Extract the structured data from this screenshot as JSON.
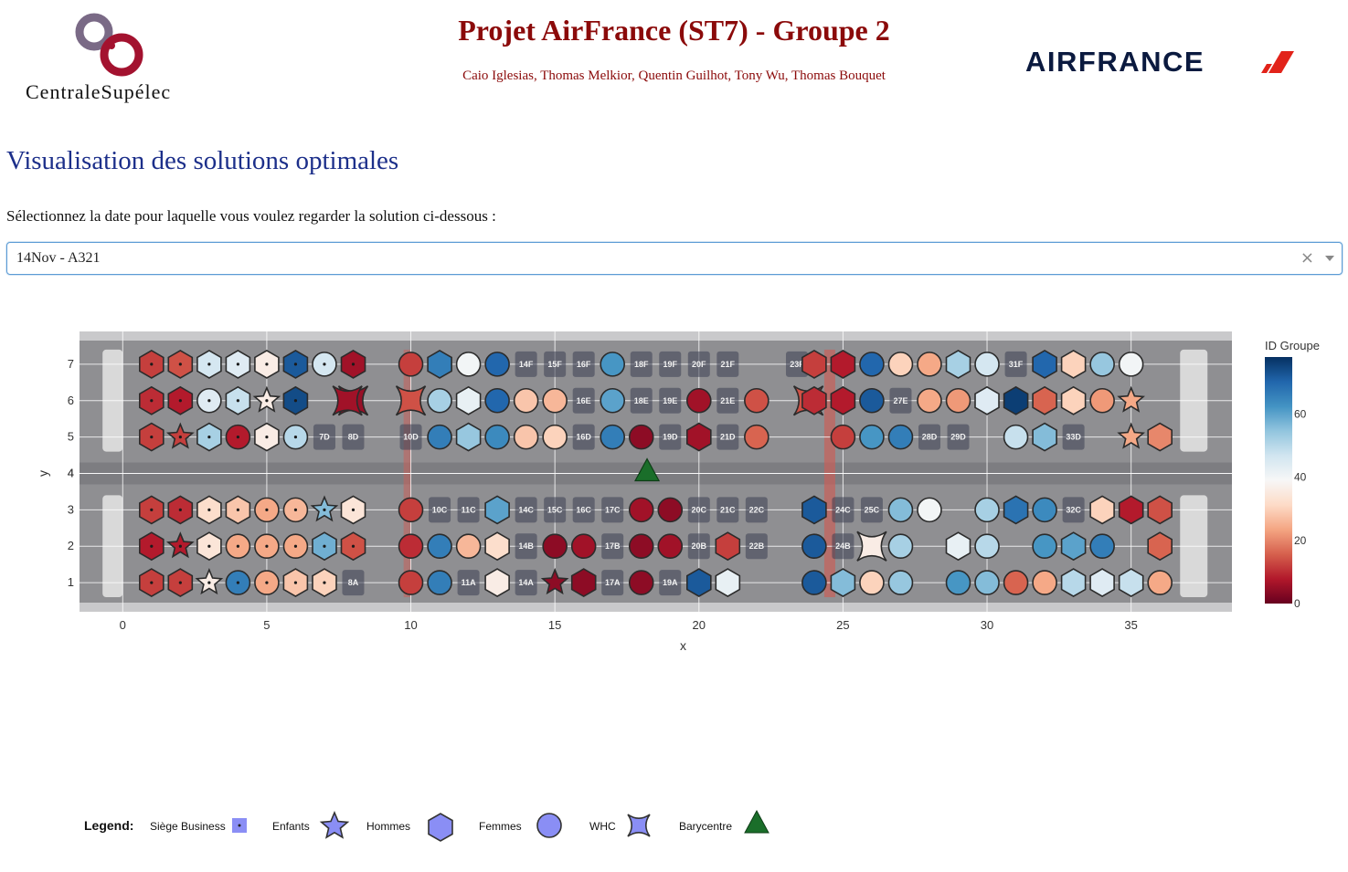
{
  "header": {
    "school_name": "CentraleSupélec",
    "title": "Projet AirFrance (ST7) - Groupe 2",
    "authors": "Caio Iglesias, Thomas Melkior, Quentin Guilhot, Tony Wu, Thomas Bouquet",
    "airline_logo_text": "AIRFRANCE",
    "title_color": "#8b0a0a"
  },
  "main": {
    "heading": "Visualisation des solutions optimales",
    "prompt": "Sélectionnez la date pour laquelle vous voulez regarder la solution ci-dessous :",
    "heading_color": "#1c2f8a"
  },
  "dropdown": {
    "selected": "14Nov - A321",
    "clear_symbol": "×"
  },
  "chart_data": {
    "type": "scatter",
    "title": "",
    "xlabel": "x",
    "ylabel": "y",
    "xlim": [
      -1.5,
      38.5
    ],
    "ylim": [
      0.2,
      7.9
    ],
    "x_ticks": [
      0,
      5,
      10,
      15,
      20,
      25,
      30,
      35
    ],
    "y_ticks": [
      1,
      2,
      3,
      4,
      5,
      6,
      7
    ],
    "grid": true,
    "colorbar": {
      "title": "ID Groupe",
      "min": 0,
      "max": 78,
      "ticks": [
        0,
        20,
        40,
        60
      ],
      "colorscale": [
        "#67001f",
        "#b2182b",
        "#d6604d",
        "#f4a582",
        "#fddbc7",
        "#f7f7f7",
        "#d1e5f0",
        "#92c5de",
        "#4393c3",
        "#2166ac",
        "#053061"
      ]
    },
    "legend": {
      "title": "Legend:",
      "items": [
        {
          "label": "Siège Business",
          "symbol": "square-dot"
        },
        {
          "label": "Enfants",
          "symbol": "star"
        },
        {
          "label": "Hommes",
          "symbol": "hexagon"
        },
        {
          "label": "Femmes",
          "symbol": "circle"
        },
        {
          "label": "WHC",
          "symbol": "square-x"
        },
        {
          "label": "Barycentre",
          "symbol": "triangle"
        }
      ]
    },
    "barycentre": {
      "x": 18.2,
      "y": 4.0,
      "color": "#1a6e2a"
    },
    "passengers": [
      {
        "x": 1,
        "y": 7,
        "s": "h",
        "g": 12,
        "b": 1
      },
      {
        "x": 2,
        "y": 7,
        "s": "h",
        "g": 14,
        "b": 1
      },
      {
        "x": 3,
        "y": 7,
        "s": "h",
        "g": 46,
        "b": 1
      },
      {
        "x": 4,
        "y": 7,
        "s": "h",
        "g": 44,
        "b": 1
      },
      {
        "x": 5,
        "y": 7,
        "s": "h",
        "g": 36,
        "b": 1
      },
      {
        "x": 6,
        "y": 7,
        "s": "h",
        "g": 72,
        "b": 1
      },
      {
        "x": 7,
        "y": 7,
        "s": "c",
        "g": 46,
        "b": 1
      },
      {
        "x": 8,
        "y": 7,
        "s": "h",
        "g": 6,
        "b": 1
      },
      {
        "x": 1,
        "y": 6,
        "s": "h",
        "g": 10,
        "b": 1
      },
      {
        "x": 2,
        "y": 6,
        "s": "h",
        "g": 8,
        "b": 1
      },
      {
        "x": 3,
        "y": 6,
        "s": "c",
        "g": 44,
        "b": 1
      },
      {
        "x": 4,
        "y": 6,
        "s": "h",
        "g": 48,
        "b": 1
      },
      {
        "x": 5,
        "y": 6,
        "s": "s",
        "g": 36,
        "b": 1
      },
      {
        "x": 6,
        "y": 6,
        "s": "h",
        "g": 74,
        "b": 1
      },
      {
        "x": 8,
        "y": 6,
        "s": "w",
        "g": 5,
        "b": 1
      },
      {
        "x": 1,
        "y": 5,
        "s": "h",
        "g": 12,
        "b": 1
      },
      {
        "x": 2,
        "y": 5,
        "s": "s",
        "g": 12,
        "b": 1
      },
      {
        "x": 3,
        "y": 5,
        "s": "h",
        "g": 52,
        "b": 1
      },
      {
        "x": 4,
        "y": 5,
        "s": "c",
        "g": 8,
        "b": 1
      },
      {
        "x": 5,
        "y": 5,
        "s": "h",
        "g": 36,
        "b": 1
      },
      {
        "x": 6,
        "y": 5,
        "s": "c",
        "g": 50,
        "b": 1
      },
      {
        "x": 1,
        "y": 3,
        "s": "h",
        "g": 12,
        "b": 1
      },
      {
        "x": 2,
        "y": 3,
        "s": "h",
        "g": 10,
        "b": 1
      },
      {
        "x": 3,
        "y": 3,
        "s": "h",
        "g": 32,
        "b": 1
      },
      {
        "x": 4,
        "y": 3,
        "s": "h",
        "g": 28,
        "b": 1
      },
      {
        "x": 5,
        "y": 3,
        "s": "c",
        "g": 24,
        "b": 1
      },
      {
        "x": 6,
        "y": 3,
        "s": "c",
        "g": 26,
        "b": 1
      },
      {
        "x": 7,
        "y": 3,
        "s": "s",
        "g": 56,
        "b": 1
      },
      {
        "x": 8,
        "y": 3,
        "s": "h",
        "g": 34,
        "b": 1
      },
      {
        "x": 1,
        "y": 2,
        "s": "h",
        "g": 8,
        "b": 1
      },
      {
        "x": 2,
        "y": 2,
        "s": "s",
        "g": 8,
        "b": 1
      },
      {
        "x": 3,
        "y": 2,
        "s": "h",
        "g": 34,
        "b": 1
      },
      {
        "x": 4,
        "y": 2,
        "s": "c",
        "g": 24,
        "b": 1
      },
      {
        "x": 5,
        "y": 2,
        "s": "c",
        "g": 24,
        "b": 1
      },
      {
        "x": 6,
        "y": 2,
        "s": "c",
        "g": 24,
        "b": 1
      },
      {
        "x": 7,
        "y": 2,
        "s": "h",
        "g": 58,
        "b": 1
      },
      {
        "x": 8,
        "y": 2,
        "s": "h",
        "g": 14,
        "b": 1
      },
      {
        "x": 1,
        "y": 1,
        "s": "h",
        "g": 12,
        "b": 1
      },
      {
        "x": 2,
        "y": 1,
        "s": "h",
        "g": 12,
        "b": 1
      },
      {
        "x": 3,
        "y": 1,
        "s": "s",
        "g": 36,
        "b": 1
      },
      {
        "x": 4,
        "y": 1,
        "s": "c",
        "g": 66,
        "b": 1
      },
      {
        "x": 5,
        "y": 1,
        "s": "c",
        "g": 24,
        "b": 1
      },
      {
        "x": 6,
        "y": 1,
        "s": "h",
        "g": 28,
        "b": 1
      },
      {
        "x": 7,
        "y": 1,
        "s": "h",
        "g": 30,
        "b": 1
      },
      {
        "x": 10,
        "y": 7,
        "s": "c",
        "g": 12
      },
      {
        "x": 11,
        "y": 7,
        "s": "h",
        "g": 66
      },
      {
        "x": 12,
        "y": 7,
        "s": "c",
        "g": 40
      },
      {
        "x": 13,
        "y": 7,
        "s": "c",
        "g": 70
      },
      {
        "x": 17,
        "y": 7,
        "s": "c",
        "g": 62
      },
      {
        "x": 24,
        "y": 7,
        "s": "h",
        "g": 12
      },
      {
        "x": 25,
        "y": 7,
        "s": "h",
        "g": 8
      },
      {
        "x": 26,
        "y": 7,
        "s": "c",
        "g": 70
      },
      {
        "x": 27,
        "y": 7,
        "s": "c",
        "g": 30
      },
      {
        "x": 28,
        "y": 7,
        "s": "c",
        "g": 24
      },
      {
        "x": 29,
        "y": 7,
        "s": "h",
        "g": 52
      },
      {
        "x": 30,
        "y": 7,
        "s": "c",
        "g": 46
      },
      {
        "x": 32,
        "y": 7,
        "s": "h",
        "g": 70
      },
      {
        "x": 33,
        "y": 7,
        "s": "h",
        "g": 30
      },
      {
        "x": 34,
        "y": 7,
        "s": "c",
        "g": 54
      },
      {
        "x": 35,
        "y": 7,
        "s": "c",
        "g": 40
      },
      {
        "x": 7.8,
        "y": 6,
        "s": "w",
        "g": 6
      },
      {
        "x": 10,
        "y": 6,
        "s": "w",
        "g": 14
      },
      {
        "x": 11,
        "y": 6,
        "s": "c",
        "g": 52
      },
      {
        "x": 12,
        "y": 6,
        "s": "h",
        "g": 42
      },
      {
        "x": 13,
        "y": 6,
        "s": "c",
        "g": 70
      },
      {
        "x": 14,
        "y": 6,
        "s": "c",
        "g": 28
      },
      {
        "x": 15,
        "y": 6,
        "s": "c",
        "g": 26
      },
      {
        "x": 17,
        "y": 6,
        "s": "c",
        "g": 60
      },
      {
        "x": 20,
        "y": 6,
        "s": "c",
        "g": 6
      },
      {
        "x": 22,
        "y": 6,
        "s": "c",
        "g": 14
      },
      {
        "x": 23.8,
        "y": 6,
        "s": "w",
        "g": 14
      },
      {
        "x": 24,
        "y": 6,
        "s": "h",
        "g": 10
      },
      {
        "x": 25,
        "y": 6,
        "s": "h",
        "g": 8
      },
      {
        "x": 26,
        "y": 6,
        "s": "c",
        "g": 72
      },
      {
        "x": 28,
        "y": 6,
        "s": "c",
        "g": 24
      },
      {
        "x": 29,
        "y": 6,
        "s": "c",
        "g": 22
      },
      {
        "x": 30,
        "y": 6,
        "s": "h",
        "g": 44
      },
      {
        "x": 31,
        "y": 6,
        "s": "h",
        "g": 76
      },
      {
        "x": 32,
        "y": 6,
        "s": "h",
        "g": 16
      },
      {
        "x": 33,
        "y": 6,
        "s": "h",
        "g": 30
      },
      {
        "x": 34,
        "y": 6,
        "s": "c",
        "g": 22
      },
      {
        "x": 35,
        "y": 6,
        "s": "s",
        "g": 24
      },
      {
        "x": 11,
        "y": 5,
        "s": "c",
        "g": 66
      },
      {
        "x": 12,
        "y": 5,
        "s": "h",
        "g": 54
      },
      {
        "x": 13,
        "y": 5,
        "s": "c",
        "g": 64
      },
      {
        "x": 14,
        "y": 5,
        "s": "c",
        "g": 28
      },
      {
        "x": 15,
        "y": 5,
        "s": "c",
        "g": 30
      },
      {
        "x": 17,
        "y": 5,
        "s": "c",
        "g": 66
      },
      {
        "x": 18,
        "y": 5,
        "s": "c",
        "g": 4
      },
      {
        "x": 20,
        "y": 5,
        "s": "h",
        "g": 6
      },
      {
        "x": 22,
        "y": 5,
        "s": "c",
        "g": 16
      },
      {
        "x": 25,
        "y": 5,
        "s": "c",
        "g": 12
      },
      {
        "x": 26,
        "y": 5,
        "s": "c",
        "g": 62
      },
      {
        "x": 27,
        "y": 5,
        "s": "c",
        "g": 66
      },
      {
        "x": 31,
        "y": 5,
        "s": "c",
        "g": 48
      },
      {
        "x": 32,
        "y": 5,
        "s": "h",
        "g": 56
      },
      {
        "x": 35,
        "y": 5,
        "s": "s",
        "g": 24
      },
      {
        "x": 36,
        "y": 5,
        "s": "h",
        "g": 20
      },
      {
        "x": 10,
        "y": 3,
        "s": "c",
        "g": 12
      },
      {
        "x": 13,
        "y": 3,
        "s": "h",
        "g": 60
      },
      {
        "x": 18,
        "y": 3,
        "s": "c",
        "g": 6
      },
      {
        "x": 19,
        "y": 3,
        "s": "c",
        "g": 4
      },
      {
        "x": 24,
        "y": 3,
        "s": "h",
        "g": 72
      },
      {
        "x": 27,
        "y": 3,
        "s": "c",
        "g": 56
      },
      {
        "x": 28,
        "y": 3,
        "s": "c",
        "g": 40
      },
      {
        "x": 30,
        "y": 3,
        "s": "c",
        "g": 52
      },
      {
        "x": 31,
        "y": 3,
        "s": "h",
        "g": 68
      },
      {
        "x": 32,
        "y": 3,
        "s": "c",
        "g": 64
      },
      {
        "x": 34,
        "y": 3,
        "s": "h",
        "g": 30
      },
      {
        "x": 35,
        "y": 3,
        "s": "h",
        "g": 8
      },
      {
        "x": 36,
        "y": 3,
        "s": "h",
        "g": 14
      },
      {
        "x": 10,
        "y": 2,
        "s": "c",
        "g": 10
      },
      {
        "x": 11,
        "y": 2,
        "s": "c",
        "g": 66
      },
      {
        "x": 12,
        "y": 2,
        "s": "c",
        "g": 26
      },
      {
        "x": 13,
        "y": 2,
        "s": "h",
        "g": 32
      },
      {
        "x": 15,
        "y": 2,
        "s": "c",
        "g": 4
      },
      {
        "x": 16,
        "y": 2,
        "s": "c",
        "g": 6
      },
      {
        "x": 18,
        "y": 2,
        "s": "c",
        "g": 4
      },
      {
        "x": 19,
        "y": 2,
        "s": "c",
        "g": 6
      },
      {
        "x": 21,
        "y": 2,
        "s": "h",
        "g": 12
      },
      {
        "x": 24,
        "y": 2,
        "s": "c",
        "g": 72
      },
      {
        "x": 26,
        "y": 2,
        "s": "w",
        "g": 36
      },
      {
        "x": 27,
        "y": 2,
        "s": "c",
        "g": 52
      },
      {
        "x": 29,
        "y": 2,
        "s": "h",
        "g": 42
      },
      {
        "x": 30,
        "y": 2,
        "s": "c",
        "g": 50
      },
      {
        "x": 32,
        "y": 2,
        "s": "c",
        "g": 62
      },
      {
        "x": 33,
        "y": 2,
        "s": "h",
        "g": 60
      },
      {
        "x": 34,
        "y": 2,
        "s": "c",
        "g": 66
      },
      {
        "x": 36,
        "y": 2,
        "s": "h",
        "g": 16
      },
      {
        "x": 10,
        "y": 1,
        "s": "c",
        "g": 12
      },
      {
        "x": 11,
        "y": 1,
        "s": "c",
        "g": 66
      },
      {
        "x": 13,
        "y": 1,
        "s": "h",
        "g": 36
      },
      {
        "x": 15,
        "y": 1,
        "s": "s",
        "g": 4
      },
      {
        "x": 16,
        "y": 1,
        "s": "h",
        "g": 4
      },
      {
        "x": 18,
        "y": 1,
        "s": "c",
        "g": 4
      },
      {
        "x": 20,
        "y": 1,
        "s": "h",
        "g": 72
      },
      {
        "x": 21,
        "y": 1,
        "s": "h",
        "g": 42
      },
      {
        "x": 24,
        "y": 1,
        "s": "c",
        "g": 72
      },
      {
        "x": 25,
        "y": 1,
        "s": "h",
        "g": 56
      },
      {
        "x": 26,
        "y": 1,
        "s": "c",
        "g": 30
      },
      {
        "x": 27,
        "y": 1,
        "s": "c",
        "g": 54
      },
      {
        "x": 29,
        "y": 1,
        "s": "c",
        "g": 62
      },
      {
        "x": 30,
        "y": 1,
        "s": "c",
        "g": 56
      },
      {
        "x": 31,
        "y": 1,
        "s": "c",
        "g": 16
      },
      {
        "x": 32,
        "y": 1,
        "s": "c",
        "g": 24
      },
      {
        "x": 33,
        "y": 1,
        "s": "h",
        "g": 50
      },
      {
        "x": 34,
        "y": 1,
        "s": "h",
        "g": 44
      },
      {
        "x": 35,
        "y": 1,
        "s": "h",
        "g": 48
      },
      {
        "x": 36,
        "y": 1,
        "s": "c",
        "g": 24
      }
    ],
    "seat_labels": [
      {
        "x": 14,
        "y": 7,
        "t": "14F"
      },
      {
        "x": 15,
        "y": 7,
        "t": "15F"
      },
      {
        "x": 16,
        "y": 7,
        "t": "16F"
      },
      {
        "x": 18,
        "y": 7,
        "t": "18F"
      },
      {
        "x": 19,
        "y": 7,
        "t": "19F"
      },
      {
        "x": 20,
        "y": 7,
        "t": "20F"
      },
      {
        "x": 21,
        "y": 7,
        "t": "21F"
      },
      {
        "x": 23.4,
        "y": 7,
        "t": "23F"
      },
      {
        "x": 31,
        "y": 7,
        "t": "31F"
      },
      {
        "x": 16,
        "y": 6,
        "t": "16E"
      },
      {
        "x": 18,
        "y": 6,
        "t": "18E"
      },
      {
        "x": 19,
        "y": 6,
        "t": "19E"
      },
      {
        "x": 21,
        "y": 6,
        "t": "21E"
      },
      {
        "x": 27,
        "y": 6,
        "t": "27E"
      },
      {
        "x": 7,
        "y": 5,
        "t": "7D"
      },
      {
        "x": 8,
        "y": 5,
        "t": "8D"
      },
      {
        "x": 10,
        "y": 5,
        "t": "10D"
      },
      {
        "x": 16,
        "y": 5,
        "t": "16D"
      },
      {
        "x": 19,
        "y": 5,
        "t": "19D"
      },
      {
        "x": 21,
        "y": 5,
        "t": "21D"
      },
      {
        "x": 28,
        "y": 5,
        "t": "28D"
      },
      {
        "x": 29,
        "y": 5,
        "t": "29D"
      },
      {
        "x": 33,
        "y": 5,
        "t": "33D"
      },
      {
        "x": 11,
        "y": 3,
        "t": "10C"
      },
      {
        "x": 12,
        "y": 3,
        "t": "11C"
      },
      {
        "x": 14,
        "y": 3,
        "t": "14C"
      },
      {
        "x": 15,
        "y": 3,
        "t": "15C"
      },
      {
        "x": 16,
        "y": 3,
        "t": "16C"
      },
      {
        "x": 17,
        "y": 3,
        "t": "17C"
      },
      {
        "x": 20,
        "y": 3,
        "t": "20C"
      },
      {
        "x": 21,
        "y": 3,
        "t": "21C"
      },
      {
        "x": 22,
        "y": 3,
        "t": "22C"
      },
      {
        "x": 25,
        "y": 3,
        "t": "24C"
      },
      {
        "x": 26,
        "y": 3,
        "t": "25C"
      },
      {
        "x": 33,
        "y": 3,
        "t": "32C"
      },
      {
        "x": 14,
        "y": 2,
        "t": "14B"
      },
      {
        "x": 17,
        "y": 2,
        "t": "17B"
      },
      {
        "x": 20,
        "y": 2,
        "t": "20B"
      },
      {
        "x": 22,
        "y": 2,
        "t": "22B"
      },
      {
        "x": 25,
        "y": 2,
        "t": "24B"
      },
      {
        "x": 8,
        "y": 1,
        "t": "8A"
      },
      {
        "x": 12,
        "y": 1,
        "t": "11A"
      },
      {
        "x": 14,
        "y": 1,
        "t": "14A"
      },
      {
        "x": 17,
        "y": 1,
        "t": "17A"
      },
      {
        "x": 19,
        "y": 1,
        "t": "19A"
      }
    ]
  }
}
